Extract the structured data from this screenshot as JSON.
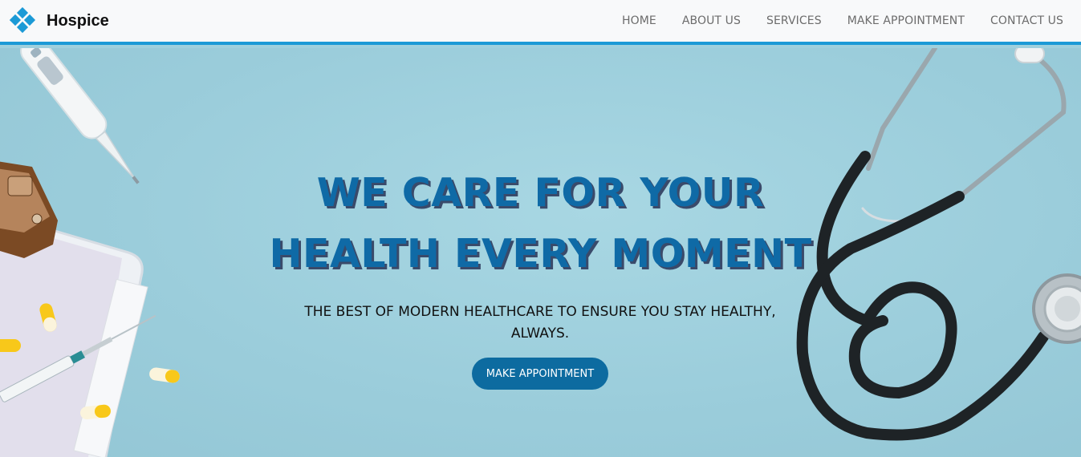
{
  "brand": {
    "name": "Hospice",
    "logo_icon": "diamond-cluster-logo-icon",
    "logo_color": "#1c9ad6"
  },
  "nav": {
    "items": [
      {
        "label": "HOME"
      },
      {
        "label": "ABOUT US"
      },
      {
        "label": "SERVICES"
      },
      {
        "label": "MAKE APPOINTMENT"
      },
      {
        "label": "CONTACT US"
      }
    ]
  },
  "hero": {
    "headline_line1": "WE CARE FOR YOUR",
    "headline_line2": "HEALTH EVERY MOMENT",
    "subheadline": "THE BEST OF MODERN HEALTHCARE TO ENSURE YOU STAY HEALTHY, ALWAYS.",
    "cta_label": "MAKE APPOINTMENT",
    "background_color": "#9fd0dd",
    "headline_color": "#0f6aa6",
    "cta_color": "#0d6ba0"
  },
  "accent_color": "#1c9ad6"
}
